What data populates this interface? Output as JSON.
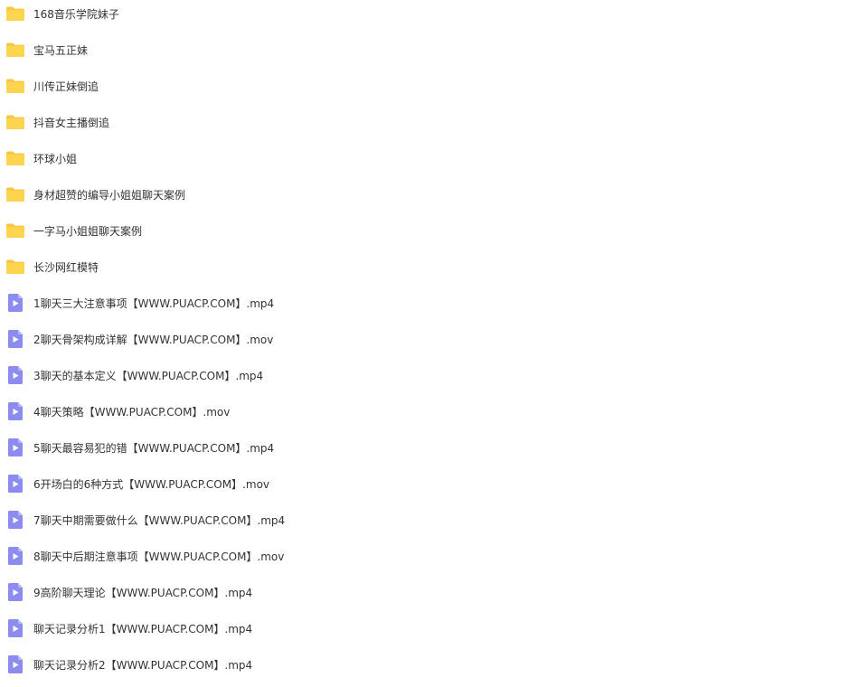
{
  "colors": {
    "folder": "#FFD54F",
    "folder_tab": "#F9C744",
    "video": "#8C8CF0",
    "video_play": "#FFFFFF",
    "text": "#333333"
  },
  "items": [
    {
      "type": "folder",
      "icon": "folder-icon",
      "name": "168音乐学院妹子"
    },
    {
      "type": "folder",
      "icon": "folder-icon",
      "name": "宝马五正妹"
    },
    {
      "type": "folder",
      "icon": "folder-icon",
      "name": "川传正妹倒追"
    },
    {
      "type": "folder",
      "icon": "folder-icon",
      "name": "抖音女主播倒追"
    },
    {
      "type": "folder",
      "icon": "folder-icon",
      "name": "环球小姐"
    },
    {
      "type": "folder",
      "icon": "folder-icon",
      "name": "身材超赞的编导小姐姐聊天案例"
    },
    {
      "type": "folder",
      "icon": "folder-icon",
      "name": "一字马小姐姐聊天案例"
    },
    {
      "type": "folder",
      "icon": "folder-icon",
      "name": "长沙网红模特"
    },
    {
      "type": "video",
      "icon": "video-file-icon",
      "name": "1聊天三大注意事项【WWW.PUACP.COM】.mp4"
    },
    {
      "type": "video",
      "icon": "video-file-icon",
      "name": "2聊天骨架构成详解【WWW.PUACP.COM】.mov"
    },
    {
      "type": "video",
      "icon": "video-file-icon",
      "name": "3聊天的基本定义【WWW.PUACP.COM】.mp4"
    },
    {
      "type": "video",
      "icon": "video-file-icon",
      "name": "4聊天策略【WWW.PUACP.COM】.mov"
    },
    {
      "type": "video",
      "icon": "video-file-icon",
      "name": "5聊天最容易犯的错【WWW.PUACP.COM】.mp4"
    },
    {
      "type": "video",
      "icon": "video-file-icon",
      "name": "6开场白的6种方式【WWW.PUACP.COM】.mov"
    },
    {
      "type": "video",
      "icon": "video-file-icon",
      "name": "7聊天中期需要做什么【WWW.PUACP.COM】.mp4"
    },
    {
      "type": "video",
      "icon": "video-file-icon",
      "name": "8聊天中后期注意事项【WWW.PUACP.COM】.mov"
    },
    {
      "type": "video",
      "icon": "video-file-icon",
      "name": "9高阶聊天理论【WWW.PUACP.COM】.mp4"
    },
    {
      "type": "video",
      "icon": "video-file-icon",
      "name": "聊天记录分析1【WWW.PUACP.COM】.mp4"
    },
    {
      "type": "video",
      "icon": "video-file-icon",
      "name": "聊天记录分析2【WWW.PUACP.COM】.mp4"
    }
  ]
}
